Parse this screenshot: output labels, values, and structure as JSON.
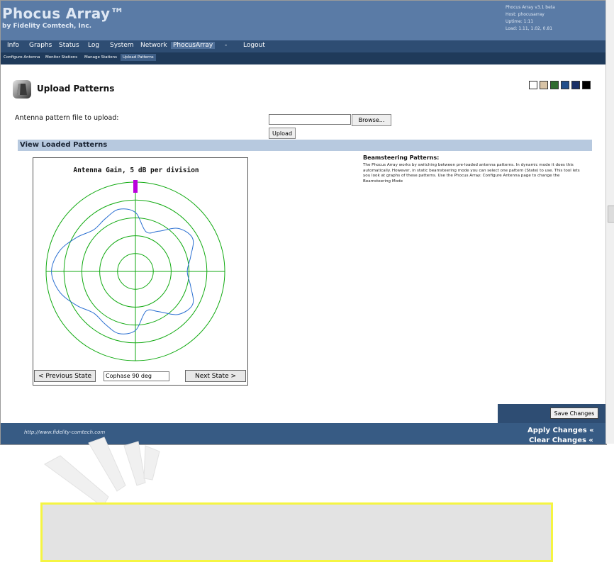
{
  "header": {
    "brand_title": "Phocus Array™",
    "brand_sub": "by Fidelity Comtech, Inc.",
    "sysinfo": [
      "Phocus Array v3.1 beta",
      "Host: phocusarray",
      "Uptime: 1:11",
      "Load: 1.11, 1.02, 0.81"
    ]
  },
  "menu": [
    "Info",
    "Graphs",
    "Status",
    "Log",
    "System",
    "Network",
    "PhocusArray",
    "-",
    "Logout"
  ],
  "submenu": [
    "Configure Antenna",
    "Monitor Stations",
    "Manage Stations",
    "Upload Patterns"
  ],
  "page": {
    "title": "Upload Patterns",
    "swatch_colors": [
      "#ffffff",
      "#d8c3a5",
      "#2f6b2f",
      "#214e8a",
      "#1a3066",
      "#000000"
    ],
    "file_label": "Antenna pattern file to upload:",
    "browse_label": "Browse...",
    "upload_label": "Upload",
    "section_title": "View Loaded Patterns"
  },
  "chart_data": {
    "type": "polar",
    "title": "Antenna Gain, 5 dB per division",
    "rings": 5,
    "grid_color": "#11aa11",
    "series_color": "#2a6fd1",
    "marker_color": "#bb00dd",
    "marker_angle_deg": 0,
    "pattern_radius_divisions": [
      {
        "angle_deg": 0,
        "r": 3.3
      },
      {
        "angle_deg": 15,
        "r": 2.3
      },
      {
        "angle_deg": 30,
        "r": 2.6
      },
      {
        "angle_deg": 45,
        "r": 3.4
      },
      {
        "angle_deg": 60,
        "r": 3.7
      },
      {
        "angle_deg": 75,
        "r": 3.2
      },
      {
        "angle_deg": 90,
        "r": 2.9
      },
      {
        "angle_deg": 105,
        "r": 3.2
      },
      {
        "angle_deg": 120,
        "r": 3.7
      },
      {
        "angle_deg": 135,
        "r": 3.4
      },
      {
        "angle_deg": 150,
        "r": 2.6
      },
      {
        "angle_deg": 165,
        "r": 2.3
      },
      {
        "angle_deg": 180,
        "r": 3.3
      },
      {
        "angle_deg": 195,
        "r": 3.6
      },
      {
        "angle_deg": 210,
        "r": 3.4
      },
      {
        "angle_deg": 225,
        "r": 3.3
      },
      {
        "angle_deg": 240,
        "r": 3.8
      },
      {
        "angle_deg": 255,
        "r": 4.4
      },
      {
        "angle_deg": 270,
        "r": 4.7
      },
      {
        "angle_deg": 285,
        "r": 4.4
      },
      {
        "angle_deg": 300,
        "r": 3.8
      },
      {
        "angle_deg": 315,
        "r": 3.3
      },
      {
        "angle_deg": 330,
        "r": 3.4
      },
      {
        "angle_deg": 345,
        "r": 3.6
      }
    ]
  },
  "chart_controls": {
    "prev_label": "< Previous State",
    "state_value": "Cophase 90 deg",
    "next_label": "Next State >"
  },
  "beam": {
    "title": "Beamsteering Patterns:",
    "text": "The Phocus Array works by switching between pre-loaded antenna patterns. In dynamic mode it does this automatically. However, in static beamsteering mode you can select one pattern (State) to use. This tool lets you look at graphs of these patterns. Use the Phocus Array: Configure Antenna page to change the Beamsteering Mode"
  },
  "actions": {
    "save_label": "Save Changes",
    "apply_label": "Apply Changes «",
    "clear_label": "Clear Changes «"
  },
  "footer": {
    "url": "http://www.fidelity-comtech.com"
  }
}
